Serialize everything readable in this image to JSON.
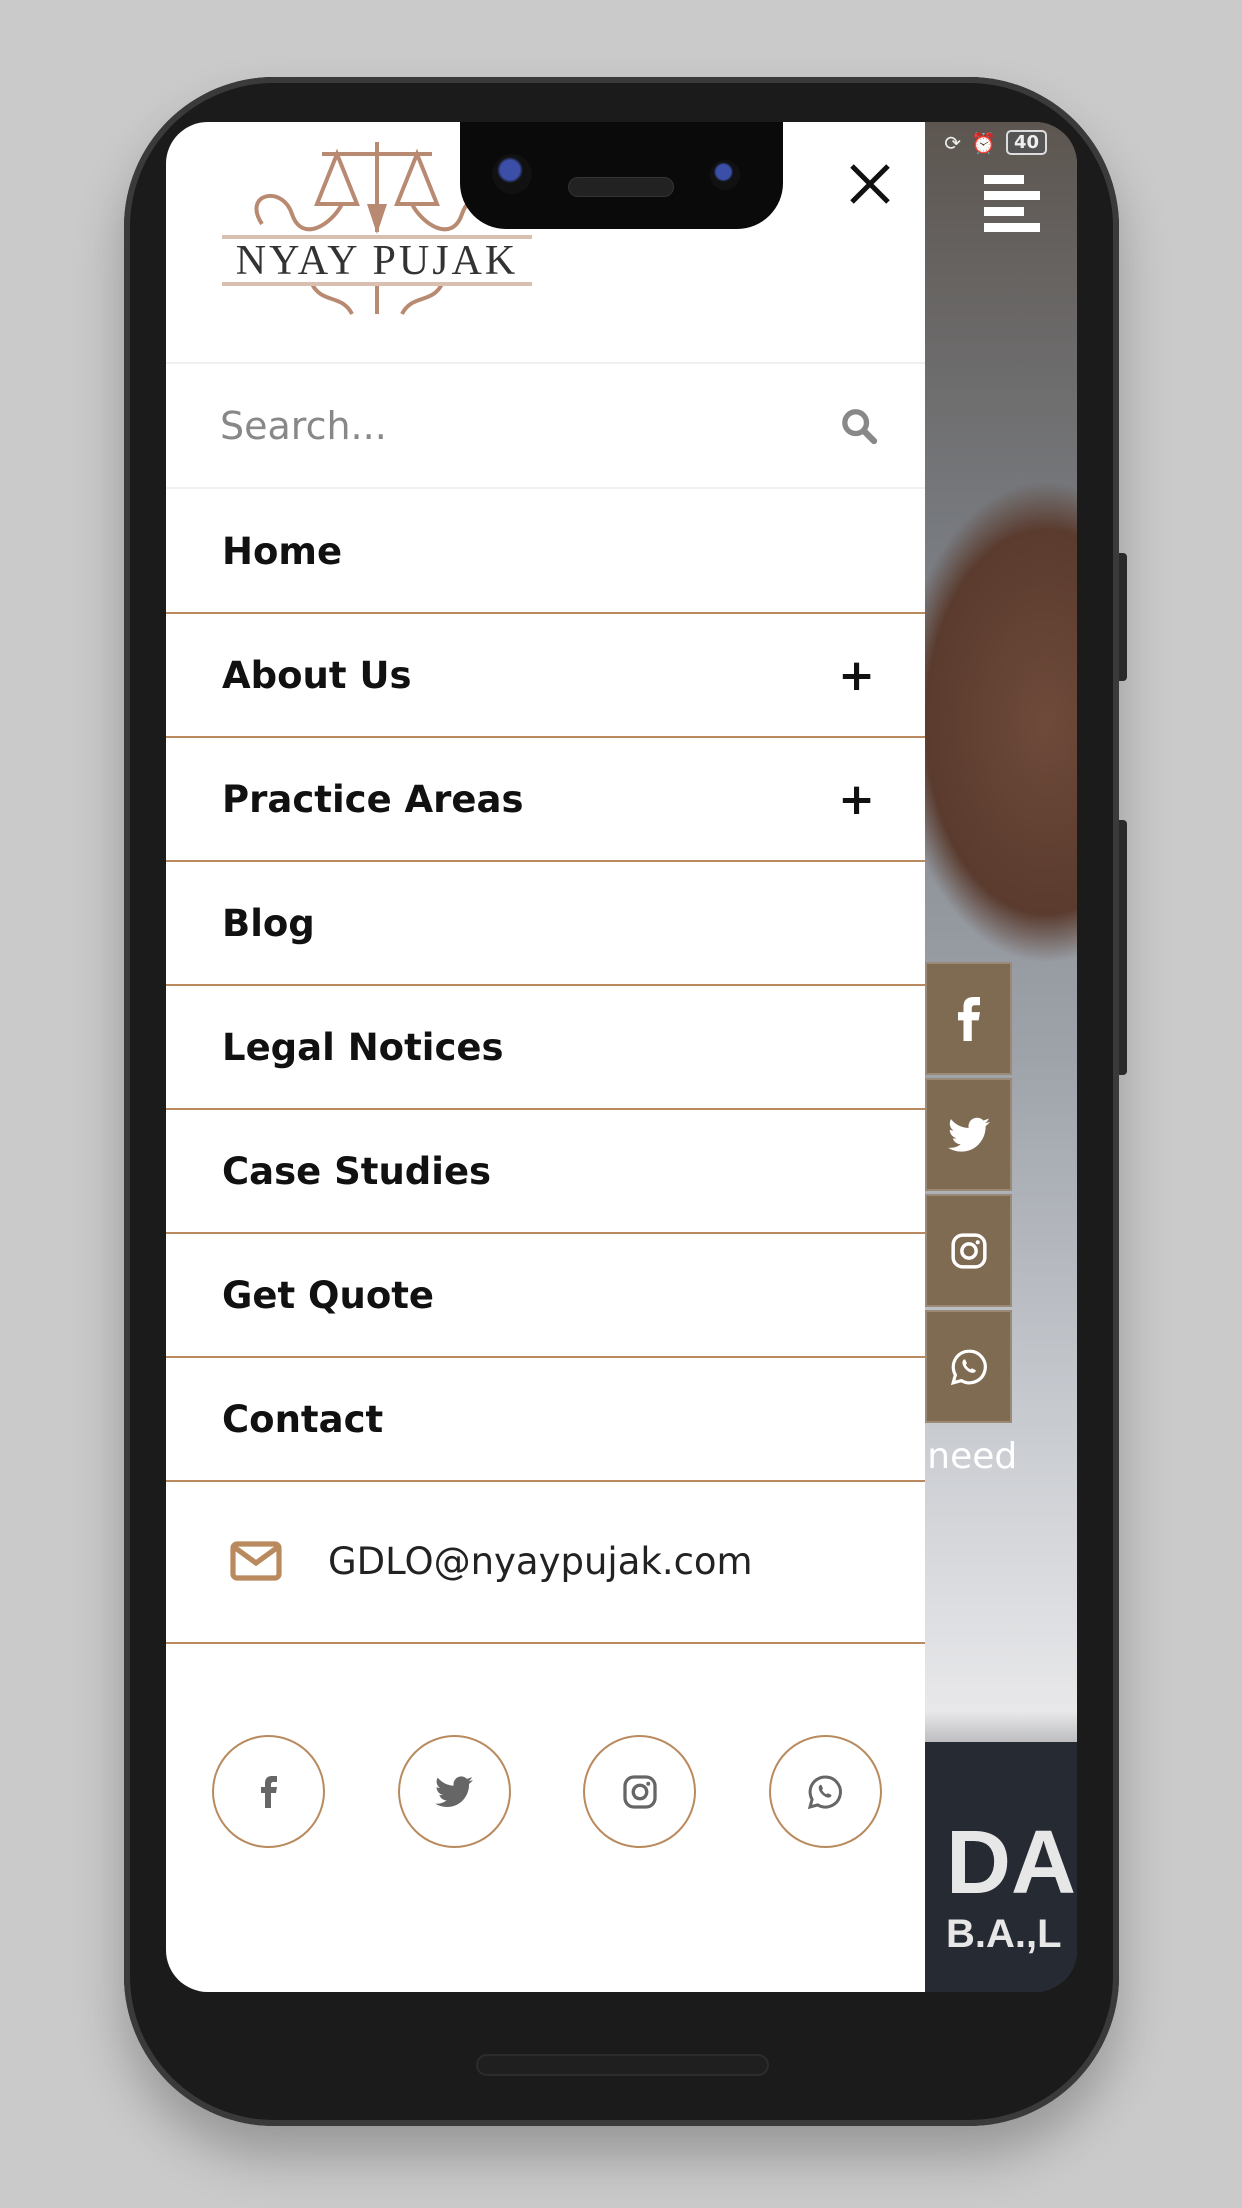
{
  "brand": {
    "logo_text": "NYAY PUJAK",
    "accent": "#b98a5e",
    "social_bar_color": "#7f6a52"
  },
  "status_bar": {
    "battery": "40"
  },
  "search": {
    "placeholder": "Search..."
  },
  "menu": {
    "items": [
      {
        "label": "Home",
        "expandable": false
      },
      {
        "label": "About Us",
        "expandable": true,
        "toggle": "+"
      },
      {
        "label": "Practice Areas",
        "expandable": true,
        "toggle": "+"
      },
      {
        "label": "Blog",
        "expandable": false
      },
      {
        "label": "Legal Notices",
        "expandable": false
      },
      {
        "label": "Case Studies",
        "expandable": false
      },
      {
        "label": "Get Quote",
        "expandable": false
      },
      {
        "label": "Contact",
        "expandable": false
      }
    ]
  },
  "contact": {
    "email": "GDLO@nyaypujak.com",
    "icon": "envelope-icon"
  },
  "socials": [
    "facebook-icon",
    "twitter-icon",
    "instagram-icon",
    "whatsapp-icon"
  ],
  "background": {
    "text_fragment": "n need",
    "plate_line1": "DA",
    "plate_line2": "B.A.,L"
  }
}
